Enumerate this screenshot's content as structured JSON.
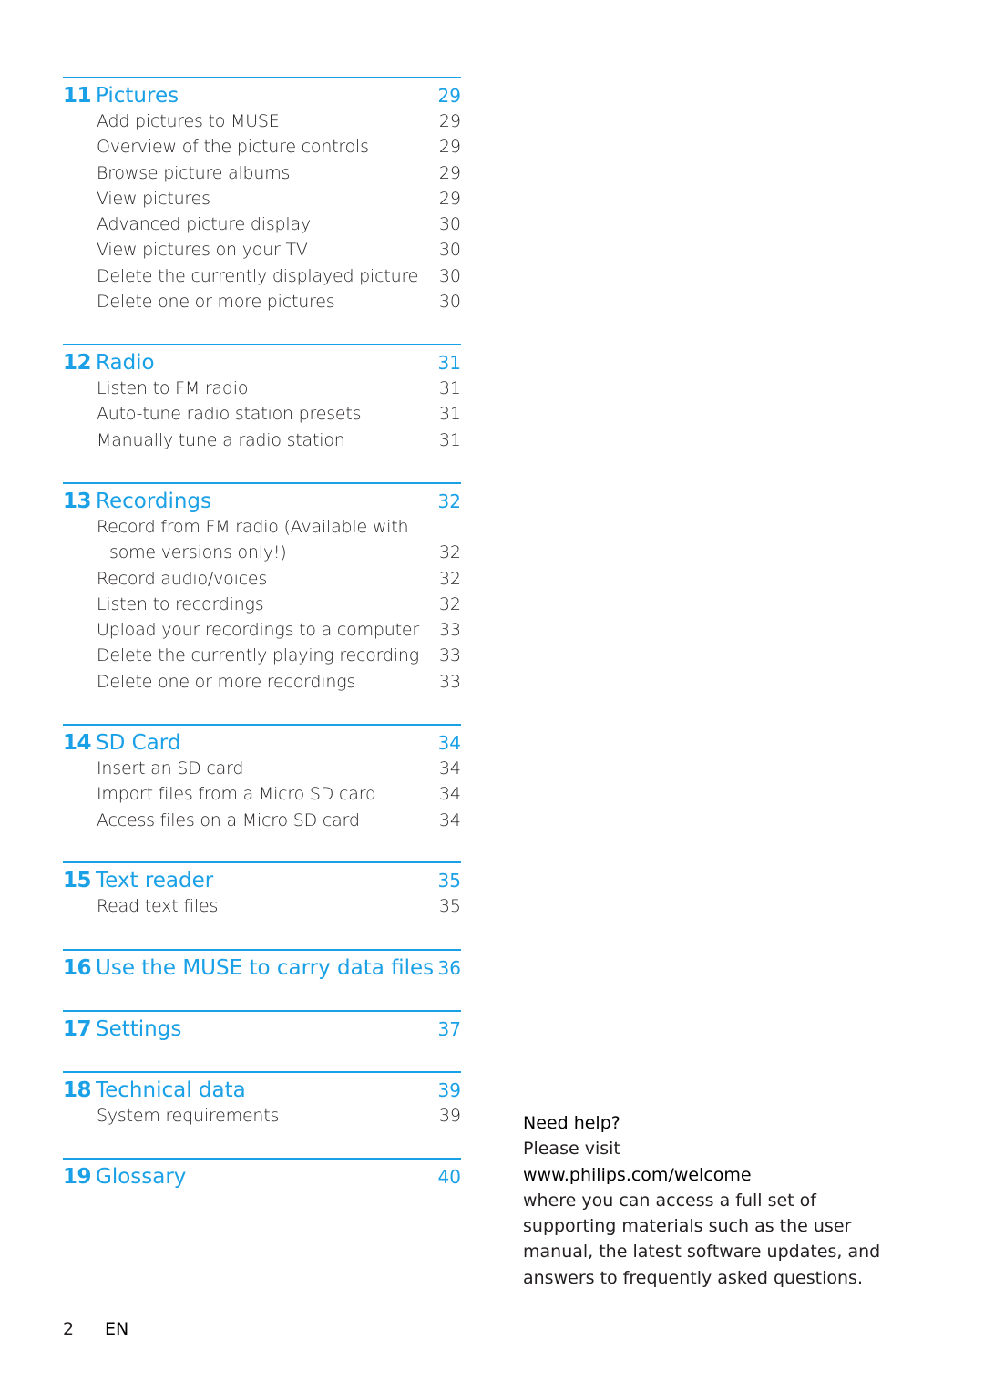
{
  "accent_color": "#1aa0e6",
  "toc": [
    {
      "number": "11",
      "title": "Pictures",
      "page": "29",
      "entries": [
        {
          "title": "Add pictures to MUSE",
          "page": "29"
        },
        {
          "title": "Overview of the picture controls",
          "page": "29"
        },
        {
          "title": "Browse picture albums",
          "page": "29"
        },
        {
          "title": "View pictures",
          "page": "29"
        },
        {
          "title": "Advanced picture display",
          "page": "30"
        },
        {
          "title": "View pictures on your TV",
          "page": "30"
        },
        {
          "title": "Delete the currently displayed picture",
          "page": "30"
        },
        {
          "title": "Delete one or more pictures",
          "page": "30"
        }
      ]
    },
    {
      "number": "12",
      "title": "Radio",
      "page": "31",
      "entries": [
        {
          "title": "Listen to FM radio",
          "page": "31"
        },
        {
          "title": "Auto-tune radio station presets",
          "page": "31"
        },
        {
          "title": "Manually tune a radio station",
          "page": "31"
        }
      ]
    },
    {
      "number": "13",
      "title": "Recordings",
      "page": "32",
      "entries": [
        {
          "title": "Record from FM radio (Available with",
          "page": ""
        },
        {
          "title": "some versions only!)",
          "page": "32",
          "indent": true
        },
        {
          "title": "Record audio/voices",
          "page": "32"
        },
        {
          "title": "Listen to recordings",
          "page": "32"
        },
        {
          "title": "Upload your recordings to a computer",
          "page": "33"
        },
        {
          "title": "Delete the currently playing recording",
          "page": "33"
        },
        {
          "title": "Delete one or more recordings",
          "page": "33"
        }
      ]
    },
    {
      "number": "14",
      "title": "SD Card",
      "page": "34",
      "entries": [
        {
          "title": "Insert an SD card",
          "page": "34"
        },
        {
          "title": "Import files from a Micro SD card",
          "page": "34"
        },
        {
          "title": "Access files on a Micro SD card",
          "page": "34"
        }
      ]
    },
    {
      "number": "15",
      "title": "Text reader",
      "page": "35",
      "entries": [
        {
          "title": "Read text files",
          "page": "35"
        }
      ]
    },
    {
      "number": "16",
      "title": "Use the MUSE to carry data files",
      "page": "36",
      "entries": []
    },
    {
      "number": "17",
      "title": "Settings",
      "page": "37",
      "entries": []
    },
    {
      "number": "18",
      "title": "Technical data",
      "page": "39",
      "entries": [
        {
          "title": "System requirements",
          "page": "39"
        }
      ]
    },
    {
      "number": "19",
      "title": "Glossary",
      "page": "40",
      "entries": []
    }
  ],
  "help": {
    "heading": "Need help?",
    "line1": "Please visit",
    "url": "www.philips.com/welcome",
    "body": "where you can access a full set of supporting materials such as the user manual, the latest software updates, and answers to frequently asked questions."
  },
  "footer": {
    "page_number": "2",
    "language": "EN"
  }
}
